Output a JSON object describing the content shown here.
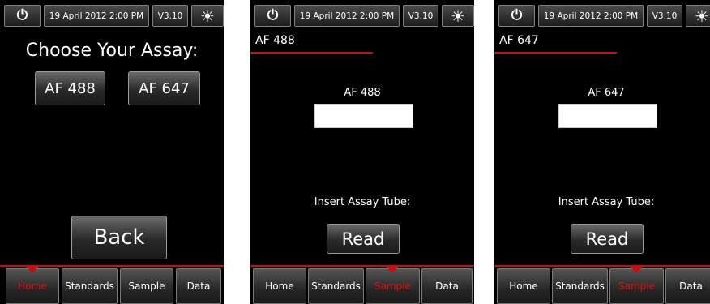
{
  "status_bar": {
    "date_time": "19 April 2012  2:00 PM",
    "version": "V3.10",
    "power_icon": "power-icon",
    "brightness_icon": "sun-icon"
  },
  "screen1": {
    "heading": "Choose Your Assay:",
    "assay_buttons": [
      "AF 488",
      "AF 647"
    ],
    "back_label": "Back"
  },
  "screen2": {
    "section_title": "AF 488",
    "assay_label": "AF 488",
    "field_value": "",
    "insert_label": "Insert Assay Tube:",
    "read_label": "Read"
  },
  "screen3": {
    "section_title": "AF 647",
    "assay_label": "AF 647",
    "field_value": "",
    "insert_label": "Insert Assay Tube:",
    "read_label": "Read"
  },
  "nav_tabs": [
    "Home",
    "Standards",
    "Sample",
    "Data"
  ],
  "active_tab": {
    "screen1": "Home",
    "screen2": "Sample",
    "screen3": "Sample"
  },
  "colors": {
    "accent_red": "#c41010",
    "active_text": "#e01010",
    "background": "#000000"
  }
}
